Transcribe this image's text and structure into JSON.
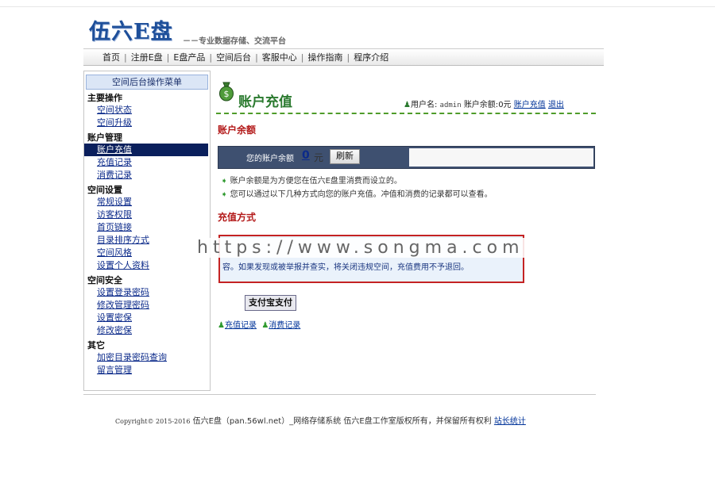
{
  "header": {
    "logo_text": "伍六E盘",
    "slogan": "－－专业数据存储、交流平台"
  },
  "nav": {
    "items": [
      "首页",
      "注册E盘",
      "E盘产品",
      "空间后台",
      "客服中心",
      "操作指南",
      "程序介绍"
    ],
    "separator": "|"
  },
  "sidebar": {
    "title": "空间后台操作菜单",
    "groups": [
      {
        "title": "主要操作",
        "items": [
          "空间状态",
          "空间升级"
        ]
      },
      {
        "title": "账户管理",
        "items": [
          "账户充值",
          "充值记录",
          "消费记录"
        ]
      },
      {
        "title": "空间设置",
        "items": [
          "常规设置",
          "访客权限",
          "首页链接",
          "目录排序方式",
          "空间风格",
          "设置个人资料"
        ]
      },
      {
        "title": "空间安全",
        "items": [
          "设置登录密码",
          "修改管理密码",
          "设置密保",
          "修改密保"
        ]
      },
      {
        "title": "其它",
        "items": [
          "加密目录密码查询",
          "留言管理"
        ]
      }
    ],
    "active_item": "账户充值"
  },
  "main": {
    "page_title": "账户充值",
    "user": {
      "label": "用户名:",
      "name": "admin",
      "balance_label": "账户余额:",
      "balance": "0元",
      "recharge_link": "账户充值",
      "logout_link": "退出"
    },
    "balance_section": {
      "title": "账户余额",
      "label": "您的账户余额",
      "value": "0",
      "unit": "元",
      "refresh_button": "刷新"
    },
    "notes": [
      "账户余额是为方便您在伍六E盘里消费而设立的。",
      "您可以通过以下几种方式向您的账户充值。冲值和消费的记录都可以查看。"
    ],
    "recharge_section": {
      "title": "充值方式",
      "warning_text": "容。如果发现或被举报并查实，将关闭违规空间，充值费用不予退回。",
      "alipay_button": "支付宝支付"
    },
    "record_links": [
      "充值记录",
      "消费记录"
    ]
  },
  "watermark": "https://www.songma.com",
  "footer": {
    "copyright_label": "Copyright© 2015-2016",
    "site": "伍六E盘（pan.56wl.net）",
    "text": "_网络存储系统 伍六E盘工作室版权所有，并保留所有权利",
    "stats_link": "站长统计"
  }
}
